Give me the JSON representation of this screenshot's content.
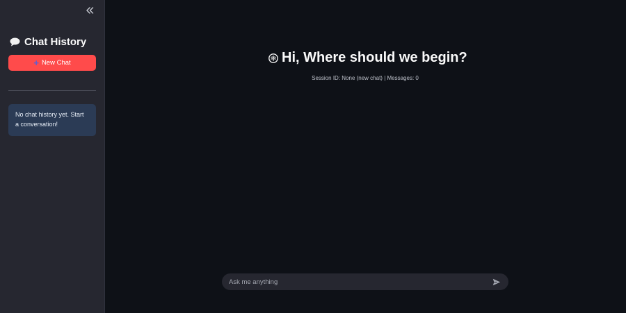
{
  "sidebar": {
    "collapse_icon": "double-chevron-left-icon",
    "title_icon": "speech-bubble-icon",
    "title": "Chat History",
    "new_chat_icon": "plus-icon",
    "new_chat_label": "New Chat",
    "empty_message": "No chat history yet. Start a conversation!"
  },
  "main": {
    "title_icon": "brain-icon",
    "title": "Hi, Where should we begin?",
    "session_info": "Session ID: None (new chat) | Messages: 0"
  },
  "chat_input": {
    "placeholder": "Ask me anything",
    "value": "",
    "send_icon": "send-icon"
  },
  "colors": {
    "background": "#0e1117",
    "sidebar": "#262730",
    "accent": "#ff4b4b",
    "info_box": "#2b3b55"
  }
}
